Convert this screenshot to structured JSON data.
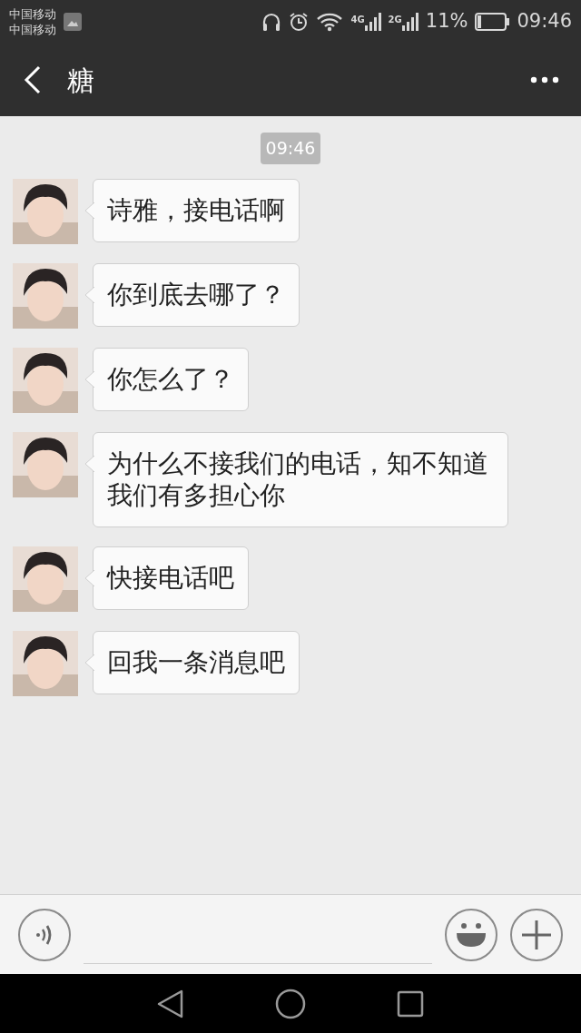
{
  "status_bar": {
    "carriers": [
      "中国移动",
      "中国移动"
    ],
    "network_labels": [
      "4G",
      "2G"
    ],
    "battery_percent": "11%",
    "time": "09:46"
  },
  "header": {
    "title": "糖"
  },
  "timestamp": "09:46",
  "messages": [
    {
      "text": "诗雅，接电话啊"
    },
    {
      "text": "你到底去哪了？"
    },
    {
      "text": "你怎么了？"
    },
    {
      "text": "为什么不接我们的电话，知不知道我们有多担心你"
    },
    {
      "text": "快接电话吧"
    },
    {
      "text": "回我一条消息吧"
    }
  ]
}
